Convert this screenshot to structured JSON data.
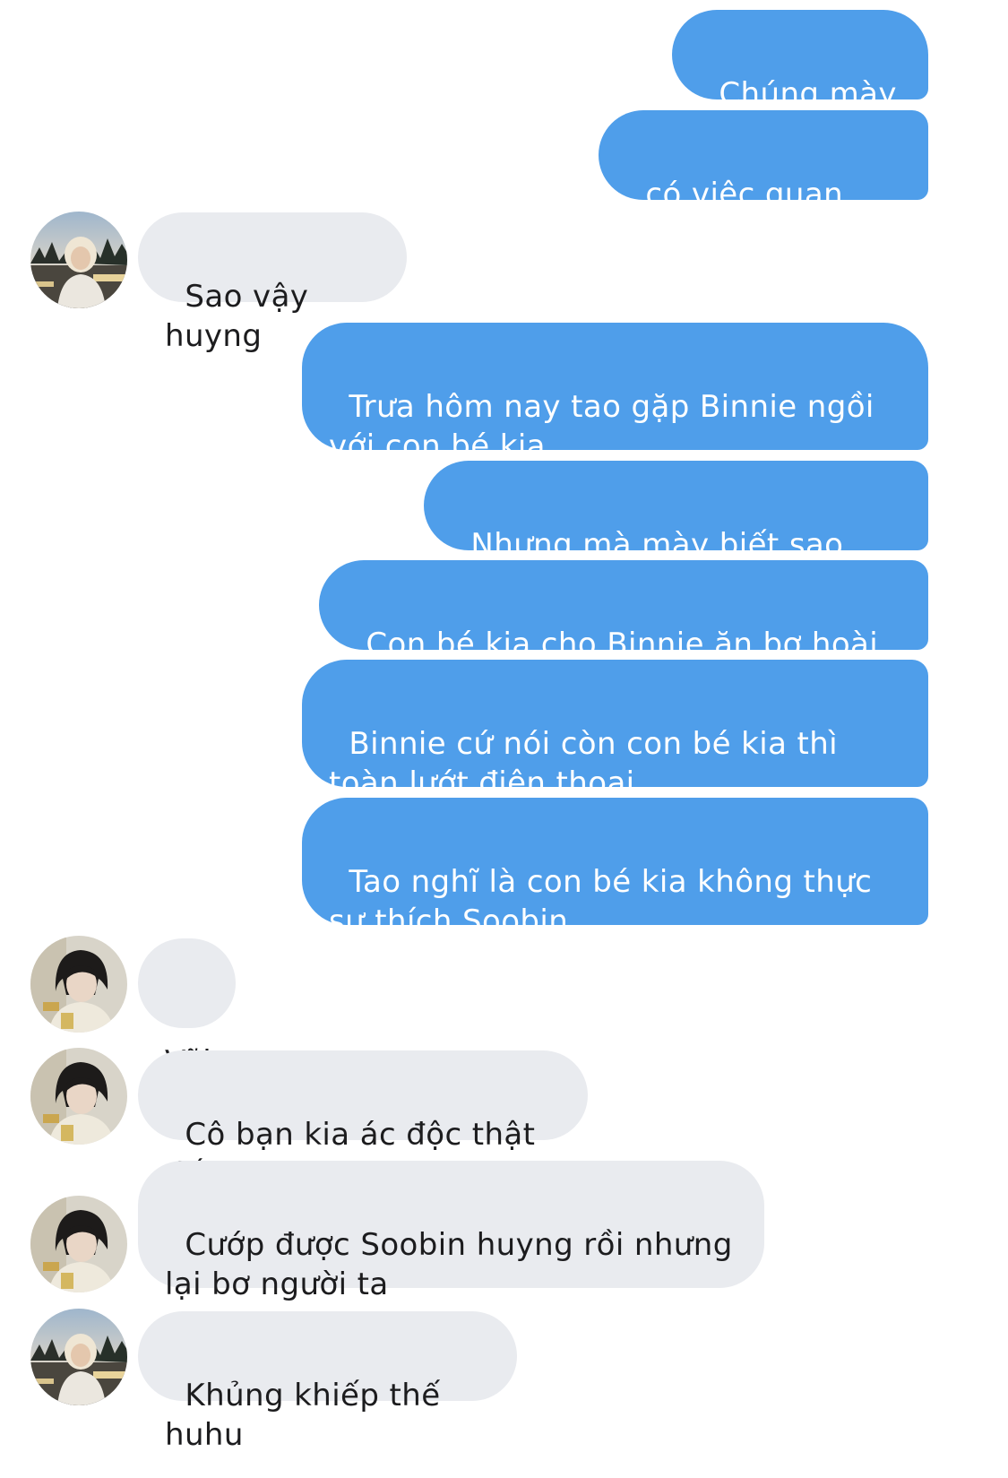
{
  "messages": [
    {
      "id": "m1",
      "direction": "outgoing",
      "text": "Chúng mày ơi"
    },
    {
      "id": "m2",
      "direction": "outgoing",
      "text": "có việc quan trọng"
    },
    {
      "id": "m3",
      "direction": "incoming",
      "sender_avatar": "avatar-blonde",
      "text": "Sao vậy huyng"
    },
    {
      "id": "m4",
      "direction": "outgoing",
      "text": "Trưa hôm nay tao gặp Binnie ngồi với con bé kia"
    },
    {
      "id": "m5",
      "direction": "outgoing",
      "text": "Nhưng mà mày biết sao không"
    },
    {
      "id": "m6",
      "direction": "outgoing",
      "text": "Con bé kia cho Binnie ăn bơ hoài luôn"
    },
    {
      "id": "m7",
      "direction": "outgoing",
      "text": "Binnie cứ nói còn con bé kia thì toàn lướt điện thoại"
    },
    {
      "id": "m8",
      "direction": "outgoing",
      "text": "Tao nghĩ là con bé kia không thực sự thích Soobin"
    },
    {
      "id": "m9",
      "direction": "incoming",
      "sender_avatar": "avatar-dark-hair",
      "text": "Vãi"
    },
    {
      "id": "m10",
      "direction": "incoming",
      "sender_avatar": "avatar-dark-hair",
      "text": "Cô bạn kia ác độc thật đấy"
    },
    {
      "id": "m11",
      "direction": "incoming",
      "sender_avatar": "avatar-dark-hair",
      "text": "Cướp được Soobin huyng rồi nhưng lại bơ người ta"
    },
    {
      "id": "m12",
      "direction": "incoming",
      "sender_avatar": "avatar-blonde",
      "text": "Khủng khiếp thế huhu"
    }
  ],
  "colors": {
    "outgoing_bubble": "#4f9eea",
    "incoming_bubble": "#e9ebef",
    "outgoing_text": "#ffffff",
    "incoming_text": "#1c1c1e"
  }
}
